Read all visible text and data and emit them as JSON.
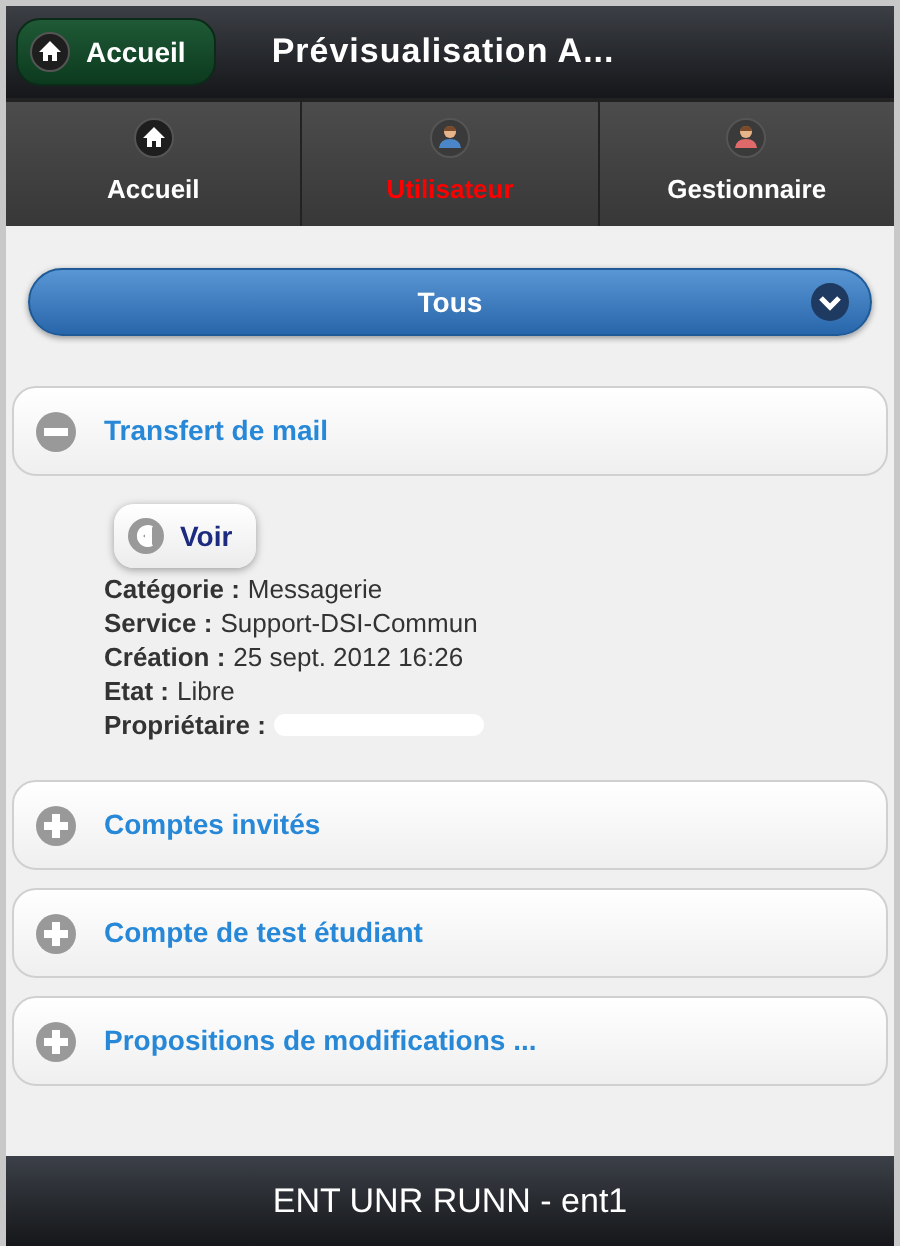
{
  "header": {
    "back_button": "Accueil",
    "title": "Prévisualisation A..."
  },
  "navbar": [
    {
      "label": "Accueil",
      "kind": "home",
      "selected": false
    },
    {
      "label": "Utilisateur",
      "kind": "user",
      "selected": true
    },
    {
      "label": "Gestionnaire",
      "kind": "manager",
      "selected": false
    }
  ],
  "filter_select": {
    "value": "Tous"
  },
  "sections": [
    {
      "title": "Transfert de mail",
      "expanded": true,
      "button": "Voir",
      "details": [
        {
          "label": "Catégorie :",
          "value": "Messagerie"
        },
        {
          "label": "Service :",
          "value": "Support-DSI-Commun"
        },
        {
          "label": "Création :",
          "value": "25 sept. 2012 16:26"
        },
        {
          "label": "Etat :",
          "value": "Libre"
        },
        {
          "label": "Propriétaire :",
          "redacted": true
        }
      ]
    },
    {
      "title": "Comptes invités",
      "expanded": false
    },
    {
      "title": "Compte de test étudiant",
      "expanded": false
    },
    {
      "title": "Propositions de modifications ...",
      "expanded": false
    }
  ],
  "footer": "ENT UNR RUNN - ent1"
}
